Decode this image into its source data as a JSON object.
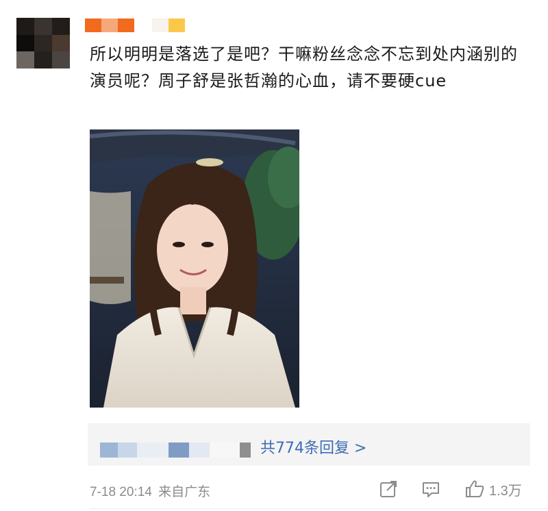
{
  "comment": {
    "username_label": "",
    "text": "所以明明是落选了是吧？干嘛粉丝念念不忘到处内涵别的演员呢？周子舒是张哲瀚的心血，请不要硬cue",
    "image": {
      "watermark": "",
      "colors": {
        "sky": "#3a4a60",
        "roof": "#2d3340",
        "tree": "#2e5a3a",
        "hair": "#3b2418",
        "robe": "#ece6dc",
        "skin": "#f4d6c6"
      }
    }
  },
  "replies": {
    "summary_link": "共774条回复 >"
  },
  "meta": {
    "date": "7-18 20:14",
    "source": "来自广东",
    "like_count": "1.3万"
  },
  "icons": [
    "share-icon",
    "comment-icon",
    "like-icon"
  ],
  "colors": {
    "link": "#3f6cb5",
    "meta": "#8b8b8b",
    "reply_bg": "#f4f4f4"
  }
}
